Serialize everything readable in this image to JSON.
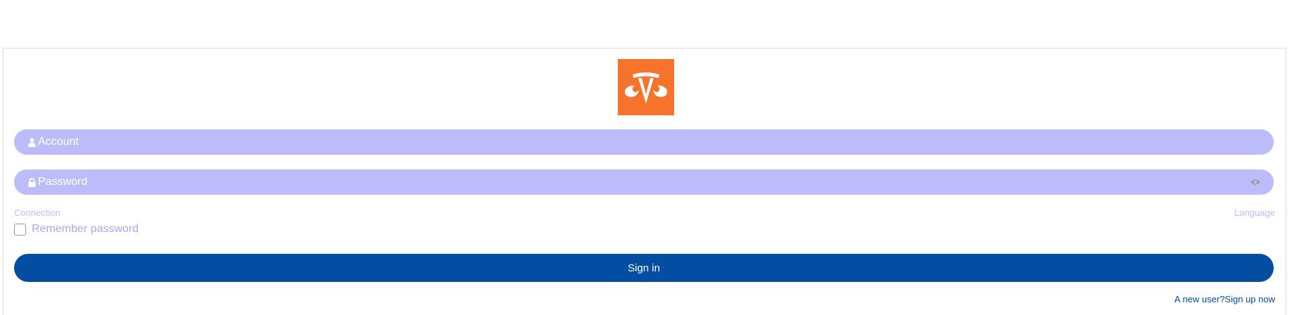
{
  "logo": {
    "icon": "scales-of-justice-icon",
    "color": "#f5732a"
  },
  "account": {
    "placeholder": "Account",
    "icon": "user-icon"
  },
  "password": {
    "placeholder": "Password",
    "icon": "lock-icon",
    "toggle_icon": "eye-icon"
  },
  "links": {
    "connection": "Connection",
    "language": "Language"
  },
  "remember": {
    "label": "Remember password",
    "checked": false
  },
  "signin": {
    "label": "Sign in",
    "color": "#034ea2"
  },
  "signup": {
    "label": "A new user?Sign up now"
  },
  "colors": {
    "field_bg": "#bdbcfb",
    "border": "#dcdcdc"
  }
}
